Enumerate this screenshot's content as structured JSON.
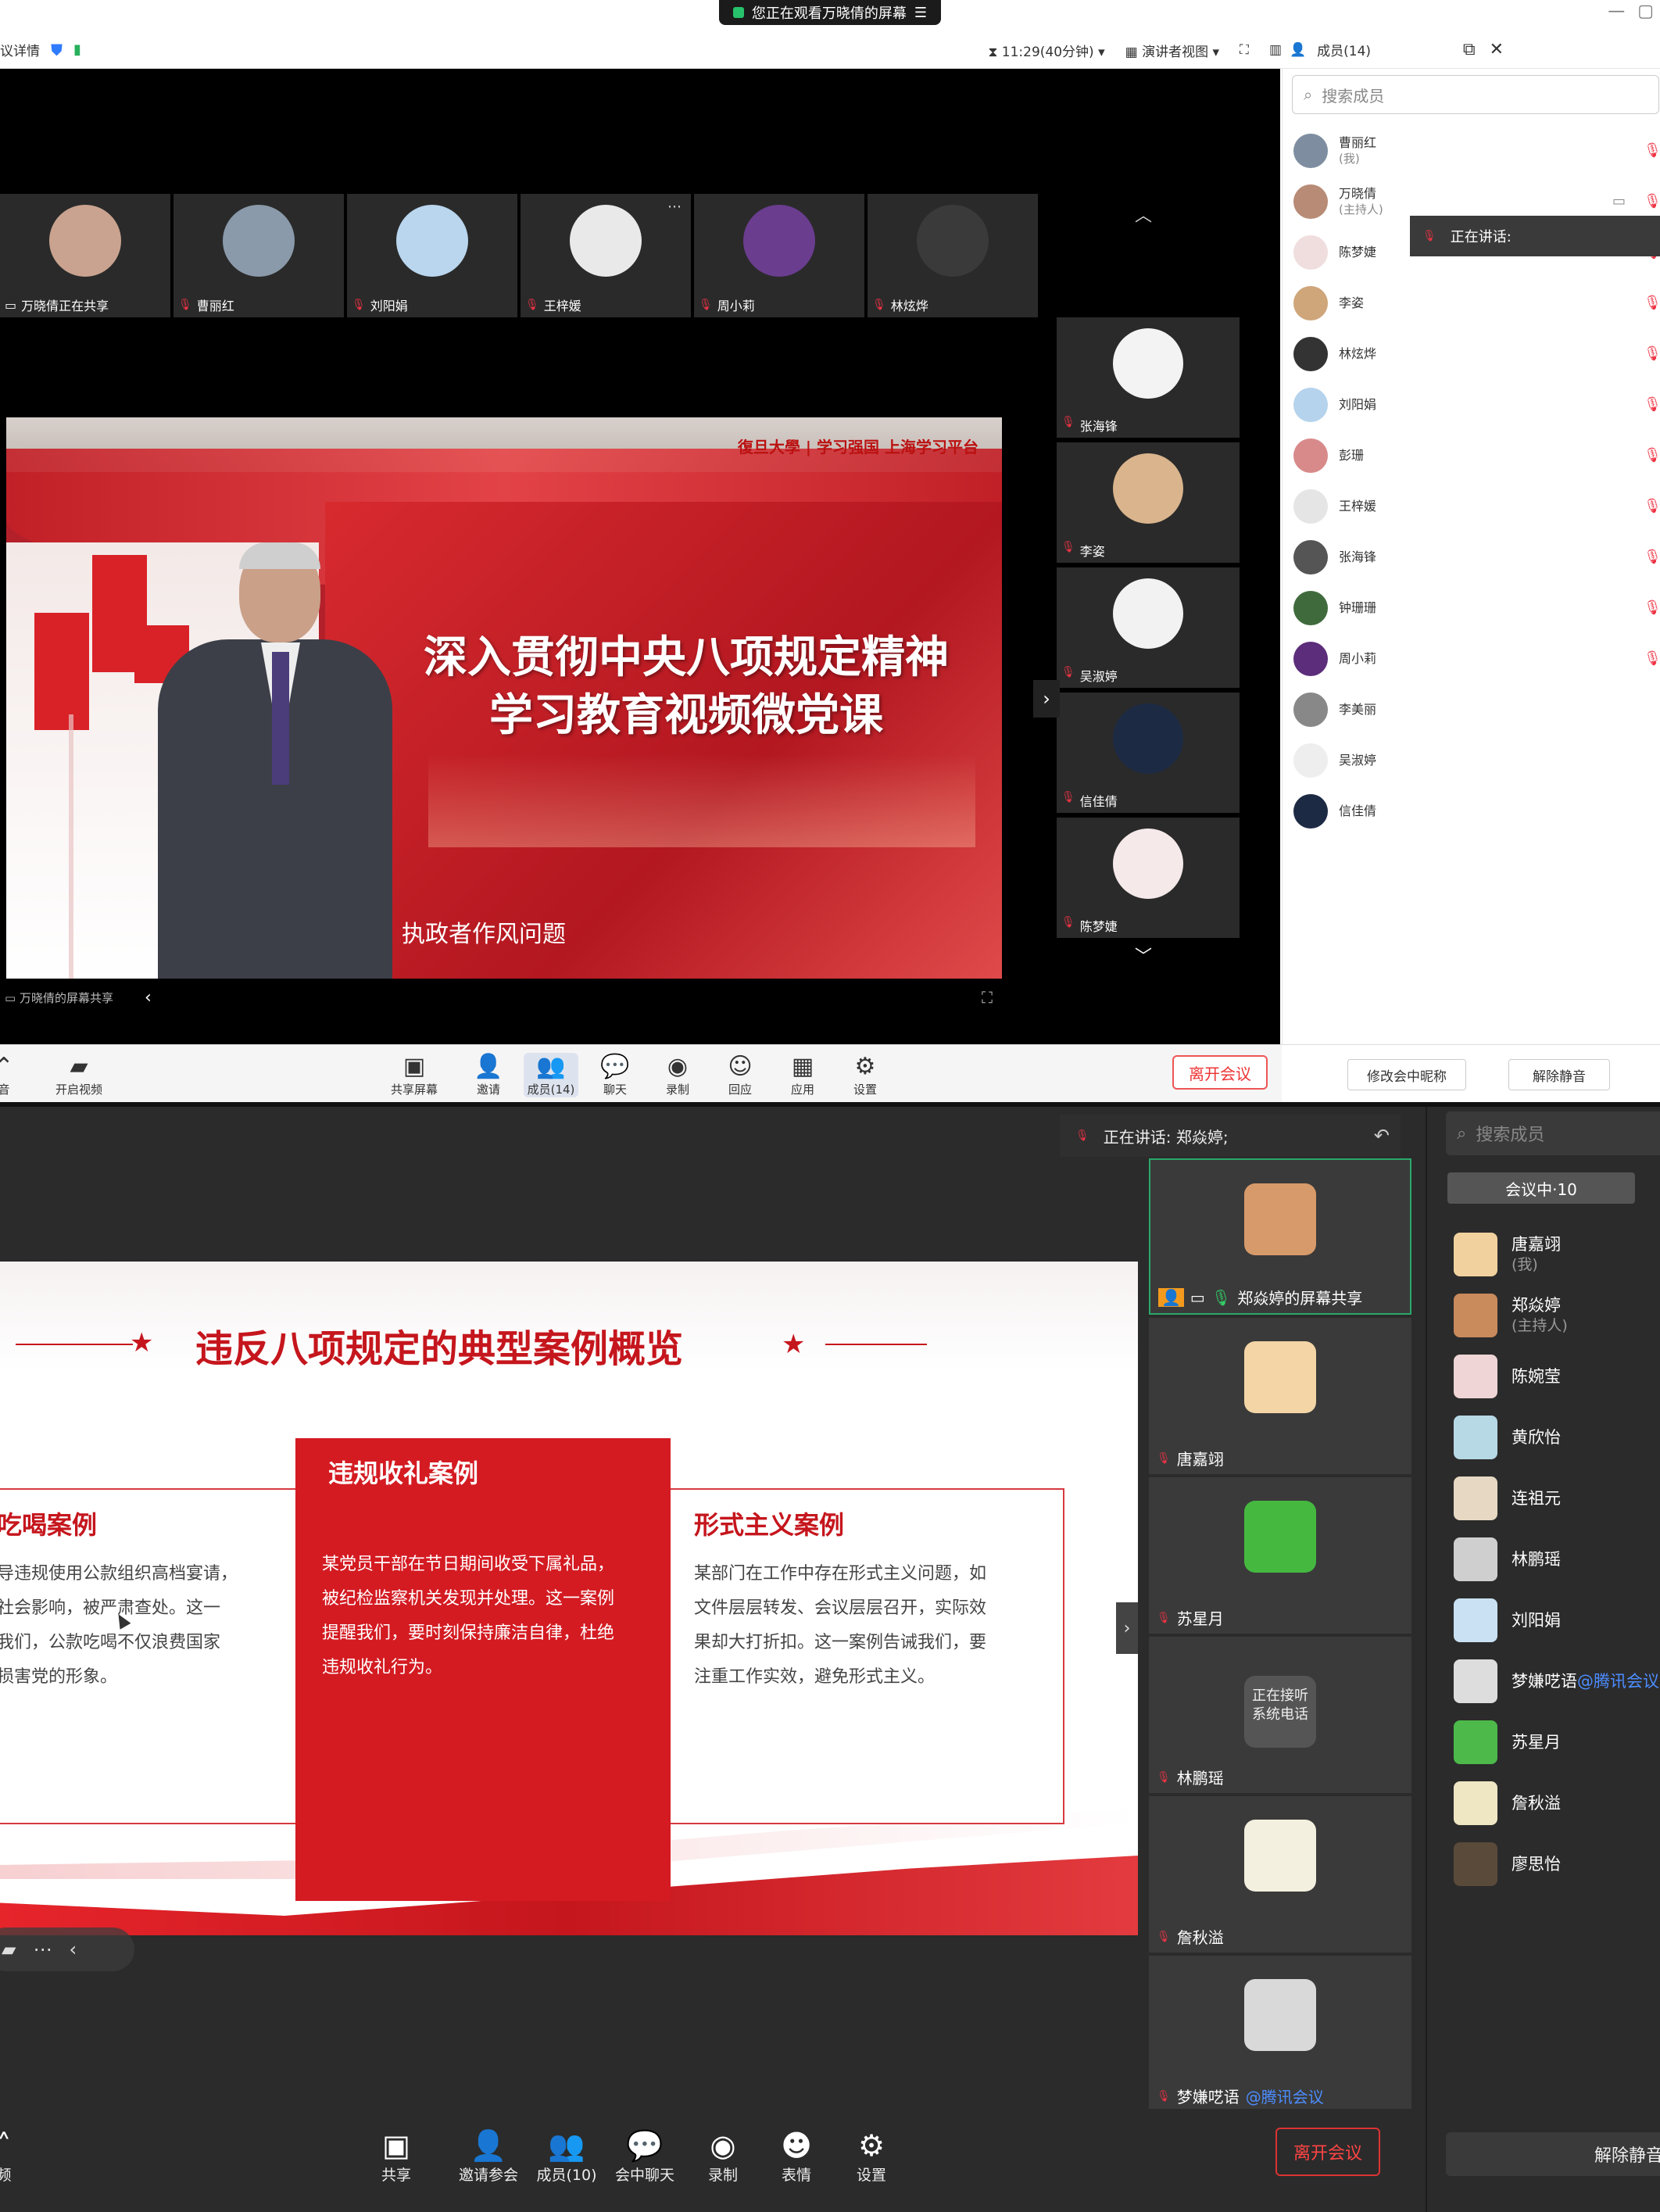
{
  "top": {
    "share_banner": "您正在观看万晓倩的屏幕",
    "menu_icon": "menu-icon",
    "title_left": "议详情",
    "timer": "11:29(40分钟)",
    "view_mode": "演讲者视图",
    "members_title": "成员(14)",
    "search_placeholder": "搜索成员",
    "speaking_label": "正在讲话:",
    "thumbs": [
      {
        "name": "万晓倩正在共享",
        "color": "#c9a38f"
      },
      {
        "name": "曹丽红",
        "color": "#8a9aaa"
      },
      {
        "name": "刘阳娟",
        "color": "#b9d6ee"
      },
      {
        "name": "王梓媛",
        "color": "#e9e9e9"
      },
      {
        "name": "周小莉",
        "color": "#6a3d8f"
      },
      {
        "name": "林炫烨",
        "color": "#3a3a3a"
      }
    ],
    "side_videos": [
      {
        "name": "张海锋",
        "color": "#f3f3f3"
      },
      {
        "name": "李姿",
        "color": "#d9b48c"
      },
      {
        "name": "吴淑婷",
        "color": "#f2f2f2"
      },
      {
        "name": "信佳倩",
        "color": "#1d2a44"
      },
      {
        "name": "陈梦婕",
        "color": "#f6e9ea"
      }
    ],
    "video": {
      "logo": "復旦大學 | 学习强国 上海学习平台",
      "title_line1": "深入贯彻中央八项规定精神",
      "title_line2": "学习教育视频微党课",
      "caption": "执政者作风问题"
    },
    "sharer_label": "万晓倩的屏幕共享",
    "members": [
      {
        "name": "曹丽红",
        "sub": "(我)",
        "color": "#7e8ea0"
      },
      {
        "name": "万晓倩",
        "sub": "(主持人)",
        "color": "#b88b76"
      },
      {
        "name": "陈梦婕",
        "sub": "",
        "color": "#f0dede"
      },
      {
        "name": "李姿",
        "sub": "",
        "color": "#cfa57a"
      },
      {
        "name": "林炫烨",
        "sub": "",
        "color": "#333333"
      },
      {
        "name": "刘阳娟",
        "sub": "",
        "color": "#b5d3ec"
      },
      {
        "name": "彭珊",
        "sub": "",
        "color": "#d88a8a"
      },
      {
        "name": "王梓媛",
        "sub": "",
        "color": "#e5e5e5"
      },
      {
        "name": "张海锋",
        "sub": "",
        "color": "#555555"
      },
      {
        "name": "钟珊珊",
        "sub": "",
        "color": "#3f6b3c"
      },
      {
        "name": "周小莉",
        "sub": "",
        "color": "#5b2d7a"
      },
      {
        "name": "李美丽",
        "sub": "",
        "color": "#888888"
      },
      {
        "name": "吴淑婷",
        "sub": "",
        "color": "#eeeeee"
      },
      {
        "name": "信佳倩",
        "sub": "",
        "color": "#1d2a44"
      }
    ],
    "toolbar": {
      "mute": "音",
      "video": "开启视频",
      "share": "共享屏幕",
      "invite": "邀请",
      "members": "成员(14)",
      "chat": "聊天",
      "record": "录制",
      "react": "回应",
      "apps": "应用",
      "settings": "设置",
      "leave": "离开会议",
      "rename": "修改会中昵称",
      "unmute": "解除静音"
    }
  },
  "bottom": {
    "speaking": "正在讲话: 郑焱婷;",
    "search_placeholder": "搜索成员",
    "tab": "会议中·10",
    "slide": {
      "title": "违反八项规定的典型案例概览",
      "case1_title": "吃喝案例",
      "case1_text": [
        "导违规使用公款组织高档宴请，",
        "社会影响，被严肃查处。这一",
        "我们，公款吃喝不仅浪费国家",
        "损害党的形象。"
      ],
      "case2_title": "违规收礼案例",
      "case2_text": [
        "某党员干部在节日期间收受下属礼品，",
        "被纪检监察机关发现并处理。这一案例",
        "提醒我们，要时刻保持廉洁自律，杜绝",
        "违规收礼行为。"
      ],
      "case3_title": "形式主义案例",
      "case3_text": [
        "某部门在工作中存在形式主义问题，如",
        "文件层层转发、会议层层召开，实际效",
        "果却大打折扣。这一案例告诫我们，要",
        "注重工作实效，避免形式主义。"
      ]
    },
    "videos": [
      {
        "name": "郑焱婷的屏幕共享",
        "color": "#d79a6a",
        "active": true
      },
      {
        "name": "唐嘉翊",
        "color": "#f3d5a6"
      },
      {
        "name": "苏星月",
        "color": "#45b93f"
      },
      {
        "name": "林鹏瑶",
        "color": "#555555",
        "phone": "正在接听 系统电话"
      },
      {
        "name": "詹秋溢",
        "color": "#f4f0df"
      },
      {
        "name": "梦嫌呓语",
        "color": "#d9d9d9",
        "link": "@腾讯会议"
      }
    ],
    "members": [
      {
        "name": "唐嘉翊",
        "sub": "(我)",
        "color": "#f1d29e"
      },
      {
        "name": "郑焱婷",
        "sub": "(主持人)",
        "color": "#c98a5c"
      },
      {
        "name": "陈婉莹",
        "sub": "",
        "color": "#efd5d5"
      },
      {
        "name": "黄欣怡",
        "sub": "",
        "color": "#b7d9e6"
      },
      {
        "name": "连祖元",
        "sub": "",
        "color": "#e6d8c2"
      },
      {
        "name": "林鹏瑶",
        "sub": "",
        "color": "#cfcfcf"
      },
      {
        "name": "刘阳娟",
        "sub": "",
        "color": "#c9e1f3"
      },
      {
        "name": "梦嫌呓语",
        "sub": "",
        "color": "#dddddd",
        "link": "@腾讯会议"
      },
      {
        "name": "苏星月",
        "sub": "",
        "color": "#4cb94a"
      },
      {
        "name": "詹秋溢",
        "sub": "",
        "color": "#efe6c4"
      },
      {
        "name": "廖思怡",
        "sub": "",
        "color": "#5a4a3a"
      }
    ],
    "toolbar": {
      "mute": "频",
      "share": "共享",
      "invite": "邀请参会",
      "members": "成员(10)",
      "chat": "会中聊天",
      "record": "录制",
      "emoji": "表情",
      "settings": "设置",
      "leave": "离开会议",
      "unmute": "解除静音"
    }
  }
}
